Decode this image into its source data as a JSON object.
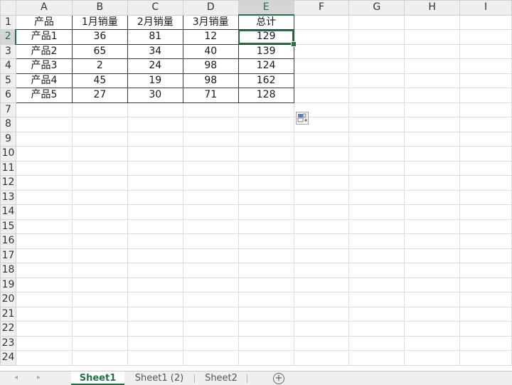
{
  "columns": [
    "A",
    "B",
    "C",
    "D",
    "E",
    "F",
    "G",
    "H",
    "I"
  ],
  "row_numbers": [
    "1",
    "2",
    "3",
    "4",
    "5",
    "6",
    "7",
    "8",
    "9",
    "10",
    "11",
    "12",
    "13",
    "14",
    "15",
    "16",
    "17",
    "18",
    "19",
    "20",
    "21",
    "22",
    "23",
    "24"
  ],
  "rows": [
    [
      "产品",
      "1月销量",
      "2月销量",
      "3月销量",
      "总计"
    ],
    [
      "产品1",
      "36",
      "81",
      "12",
      "129"
    ],
    [
      "产品2",
      "65",
      "34",
      "40",
      "139"
    ],
    [
      "产品3",
      "2",
      "24",
      "98",
      "124"
    ],
    [
      "产品4",
      "45",
      "19",
      "98",
      "162"
    ],
    [
      "产品5",
      "27",
      "30",
      "71",
      "128"
    ]
  ],
  "active_cell": "E2",
  "sheet_tabs": [
    "Sheet1",
    "Sheet1 (2)",
    "Sheet2"
  ],
  "active_sheet": "Sheet1",
  "nav_icons": [
    "tab-scroll-left-icon",
    "tab-scroll-right-icon"
  ],
  "add_sheet_label": "+",
  "colors": {
    "accent": "#217346",
    "header_bg": "#efefef",
    "gridline": "#dadcdf"
  }
}
